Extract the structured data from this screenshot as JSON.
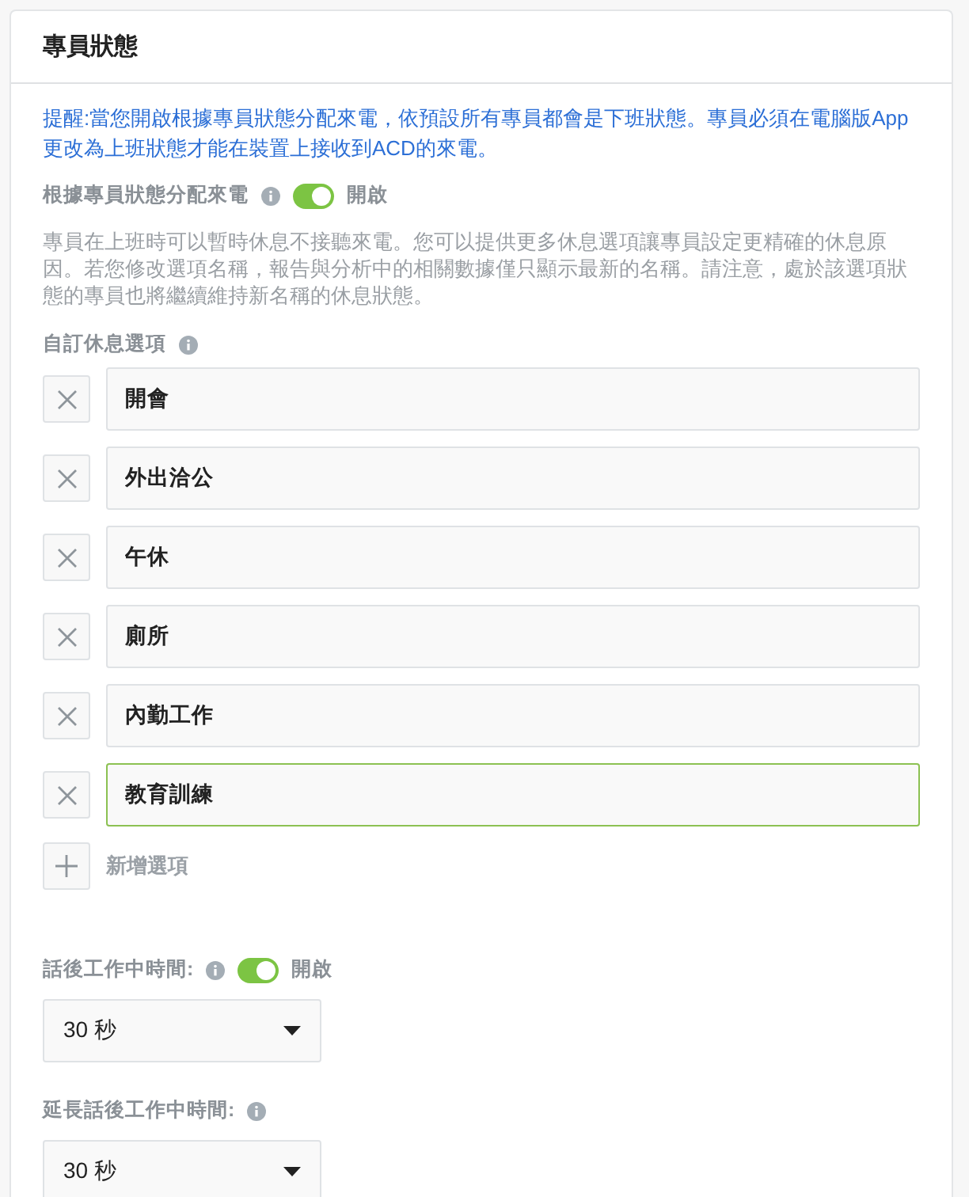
{
  "panel": {
    "title": "專員狀態"
  },
  "notice": "提醒:當您開啟根據專員狀態分配來電，依預設所有專員都會是下班狀態。專員必須在電腦版App更改為上班狀態才能在裝置上接收到ACD的來電。",
  "route_by_status": {
    "label": "根據專員狀態分配來電",
    "on": true,
    "state_text": "開啟"
  },
  "description": "專員在上班時可以暫時休息不接聽來電。您可以提供更多休息選項讓專員設定更精確的休息原因。若您修改選項名稱，報告與分析中的相關數據僅只顯示最新的名稱。請注意，處於該選項狀態的專員也將繼續維持新名稱的休息狀態。",
  "break_options": {
    "label": "自訂休息選項",
    "items": [
      {
        "value": "開會",
        "focused": false
      },
      {
        "value": "外出洽公",
        "focused": false
      },
      {
        "value": "午休",
        "focused": false
      },
      {
        "value": "廁所",
        "focused": false
      },
      {
        "value": "內勤工作",
        "focused": false
      },
      {
        "value": "教育訓練",
        "focused": true
      }
    ],
    "add_label": "新增選項"
  },
  "wrap_up": {
    "label": "話後工作中時間:",
    "on": true,
    "state_text": "開啟",
    "value": "30 秒"
  },
  "extended_wrap_up": {
    "label": "延長話後工作中時間:",
    "value": "30 秒"
  }
}
